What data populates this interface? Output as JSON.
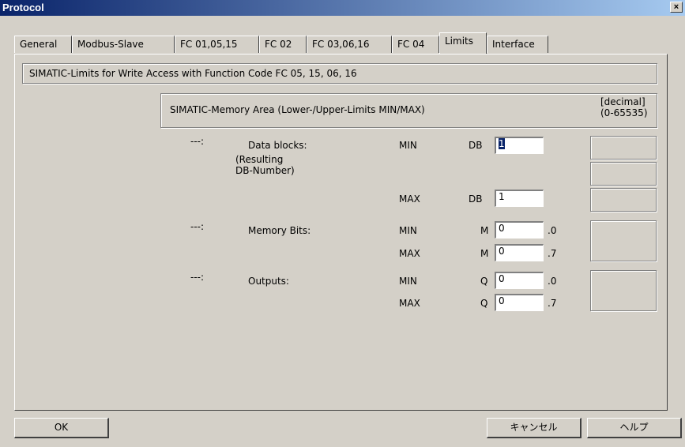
{
  "window": {
    "title": "Protocol",
    "close_glyph": "×"
  },
  "tabs": [
    {
      "label": "General"
    },
    {
      "label": "Modbus-Slave"
    },
    {
      "label": "FC 01,05,15"
    },
    {
      "label": "FC 02"
    },
    {
      "label": "FC 03,06,16"
    },
    {
      "label": "FC 04"
    },
    {
      "label": "Limits",
      "active": true
    },
    {
      "label": "Interface"
    }
  ],
  "limits": {
    "header": "SIMATIC-Limits for Write Access with Function Code  FC 05, 15,  06, 16",
    "memory_area": {
      "title": "SIMATIC-Memory Area  (Lower-/Upper-Limits  MIN/MAX)",
      "decimal_line1": "[decimal]",
      "decimal_line2": "(0-65535)"
    },
    "arrow": "---:",
    "data_blocks": {
      "label_line1": "Data blocks:",
      "label_line2": "(Resulting",
      "label_line3": "DB-Number)",
      "min_label": "MIN",
      "max_label": "MAX",
      "prefix": "DB",
      "min_value": "1",
      "max_value": "1"
    },
    "memory_bits": {
      "label": "Memory Bits:",
      "min_label": "MIN",
      "max_label": "MAX",
      "prefix": "M",
      "min_value": "0",
      "max_value": "0",
      "min_suffix": ".0",
      "max_suffix": ".7"
    },
    "outputs": {
      "label": "Outputs:",
      "min_label": "MIN",
      "max_label": "MAX",
      "prefix": "Q",
      "min_value": "0",
      "max_value": "0",
      "min_suffix": ".0",
      "max_suffix": ".7"
    }
  },
  "buttons": {
    "ok": "OK",
    "cancel": "キャンセル",
    "help": "ヘルプ"
  }
}
